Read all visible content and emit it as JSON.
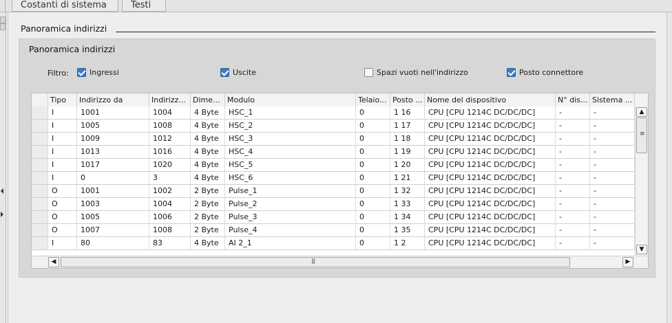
{
  "tabs": [
    {
      "label": "Costanti di sistema"
    },
    {
      "label": "Testi"
    }
  ],
  "section": {
    "title": "Panoramica indirizzi"
  },
  "panel": {
    "title": "Panoramica indirizzi"
  },
  "filter": {
    "label": "Filtro:",
    "options": [
      {
        "label": "Ingressi",
        "checked": true
      },
      {
        "label": "Uscite",
        "checked": true
      },
      {
        "label": "Spazi vuoti nell'indirizzo",
        "checked": false
      },
      {
        "label": "Posto connettore",
        "checked": true
      }
    ]
  },
  "table": {
    "columns": [
      "",
      "Tipo",
      "Indirizzo da",
      "Indirizz...",
      "Dime...",
      "Modulo",
      "Telaio...",
      "Posto ...",
      "Nome del dispositivo",
      "N° dis...",
      "Sistema ..."
    ],
    "rows": [
      [
        "I",
        "1001",
        "1004",
        "4 Byte",
        "HSC_1",
        "0",
        "1 16",
        "CPU [CPU 1214C DC/DC/DC]",
        "-",
        "-"
      ],
      [
        "I",
        "1005",
        "1008",
        "4 Byte",
        "HSC_2",
        "0",
        "1 17",
        "CPU [CPU 1214C DC/DC/DC]",
        "-",
        "-"
      ],
      [
        "I",
        "1009",
        "1012",
        "4 Byte",
        "HSC_3",
        "0",
        "1 18",
        "CPU [CPU 1214C DC/DC/DC]",
        "-",
        "-"
      ],
      [
        "I",
        "1013",
        "1016",
        "4 Byte",
        "HSC_4",
        "0",
        "1 19",
        "CPU [CPU 1214C DC/DC/DC]",
        "-",
        "-"
      ],
      [
        "I",
        "1017",
        "1020",
        "4 Byte",
        "HSC_5",
        "0",
        "1 20",
        "CPU [CPU 1214C DC/DC/DC]",
        "-",
        "-"
      ],
      [
        "I",
        "0",
        "3",
        "4 Byte",
        "HSC_6",
        "0",
        "1 21",
        "CPU [CPU 1214C DC/DC/DC]",
        "-",
        "-"
      ],
      [
        "O",
        "1001",
        "1002",
        "2 Byte",
        "Pulse_1",
        "0",
        "1 32",
        "CPU [CPU 1214C DC/DC/DC]",
        "-",
        "-"
      ],
      [
        "O",
        "1003",
        "1004",
        "2 Byte",
        "Pulse_2",
        "0",
        "1 33",
        "CPU [CPU 1214C DC/DC/DC]",
        "-",
        "-"
      ],
      [
        "O",
        "1005",
        "1006",
        "2 Byte",
        "Pulse_3",
        "0",
        "1 34",
        "CPU [CPU 1214C DC/DC/DC]",
        "-",
        "-"
      ],
      [
        "O",
        "1007",
        "1008",
        "2 Byte",
        "Pulse_4",
        "0",
        "1 35",
        "CPU [CPU 1214C DC/DC/DC]",
        "-",
        "-"
      ],
      [
        "I",
        "80",
        "83",
        "4 Byte",
        "AI 2_1",
        "0",
        "1 2",
        "CPU [CPU 1214C DC/DC/DC]",
        "-",
        "-"
      ]
    ]
  },
  "scroll": {
    "up": "▲",
    "down": "▼",
    "left": "◀",
    "right": "▶"
  }
}
